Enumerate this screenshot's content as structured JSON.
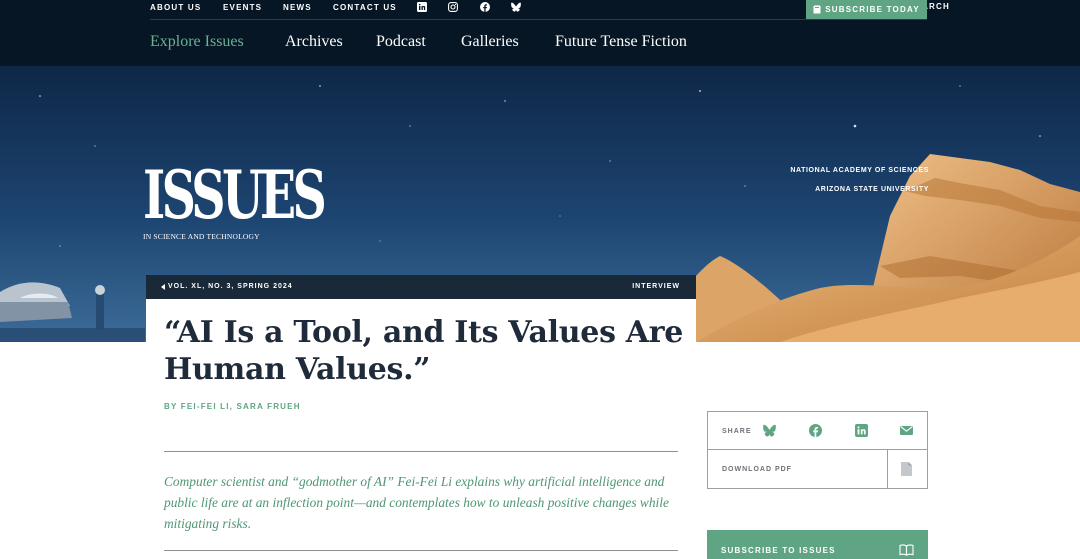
{
  "utility_nav": {
    "links": [
      "ABOUT US",
      "EVENTS",
      "NEWS",
      "CONTACT US"
    ],
    "social_icons": [
      "linkedin-icon",
      "instagram-icon",
      "facebook-icon",
      "bluesky-icon"
    ],
    "search_label": "SEARCH",
    "subscribe_label": "SUBSCRIBE TODAY"
  },
  "main_nav": {
    "items": [
      "Explore Issues",
      "Archives",
      "Podcast",
      "Galleries",
      "Future Tense Fiction"
    ],
    "active": "Explore Issues"
  },
  "hero": {
    "logo_word": "ISSUES",
    "logo_subtitle": "IN SCIENCE AND TECHNOLOGY",
    "partners": [
      "NATIONAL ACADEMY OF SCIENCES",
      "ARIZONA STATE UNIVERSITY"
    ]
  },
  "article": {
    "issue": "VOL. XL, NO. 3, SPRING 2024",
    "type": "INTERVIEW",
    "title": "“AI Is a Tool, and Its Values Are Human Values.”",
    "byline": "BY FEI-FEI LI, SARA FRUEH",
    "dek": "Computer scientist and “godmother of AI” Fei-Fei Li explains why artificial intelligence and public life are at an inflection point—and contemplates how to unleash positive changes while mitigating risks."
  },
  "sidebar": {
    "share_label": "SHARE",
    "share_icons": [
      "bluesky-icon",
      "facebook-icon",
      "linkedin-icon",
      "email-icon"
    ],
    "download_label": "DOWNLOAD PDF",
    "subscribe_label": "SUBSCRIBE TO ISSUES"
  },
  "colors": {
    "navy": "#061624",
    "green": "#5fa583",
    "text": "#1f2b3a",
    "dek": "#4e9674"
  }
}
